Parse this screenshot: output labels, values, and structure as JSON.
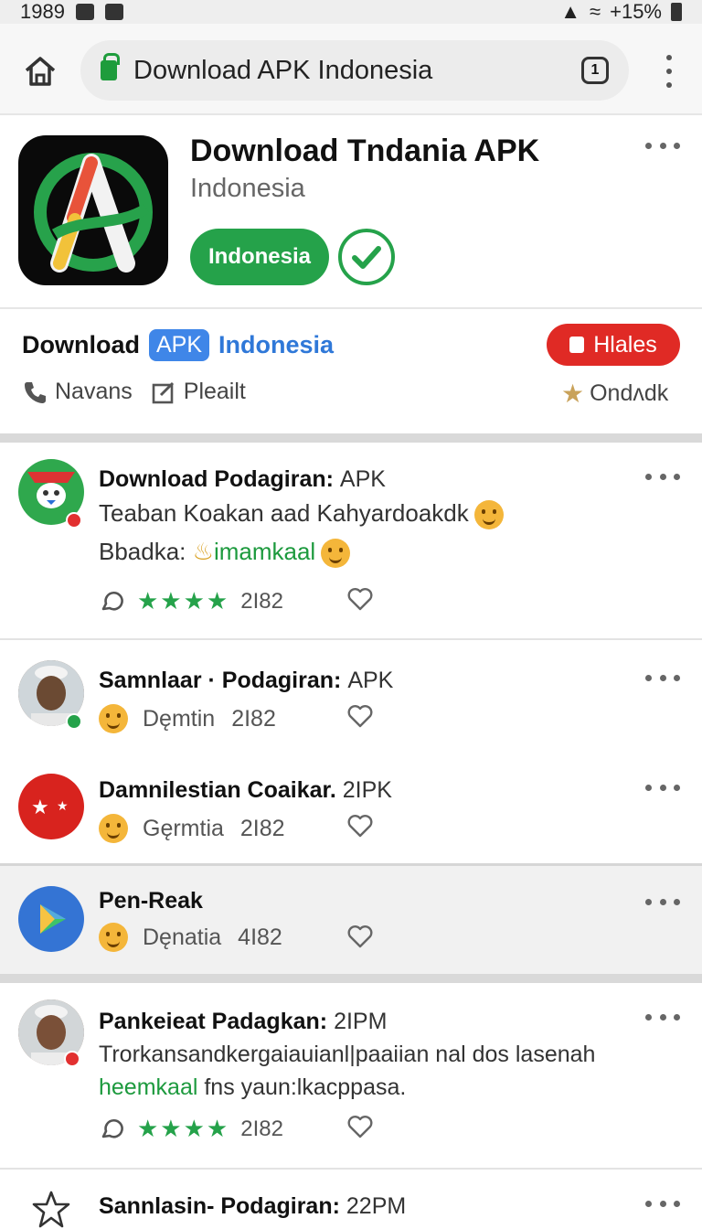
{
  "status_bar": {
    "time": "1989",
    "battery": "+15%"
  },
  "browser": {
    "url": "Download APK Indonesia",
    "tab_count": "1"
  },
  "app": {
    "title": "Download Tndania APK",
    "subtitle": "Indonesia",
    "badge": "Indonesia"
  },
  "download_strip": {
    "word": "Download",
    "chip": "APK",
    "link": "Indonesia",
    "button": "Hlales",
    "meta_left_1": "Navans",
    "meta_left_2": "Pleailt",
    "meta_right": "Ondʌdk"
  },
  "posts": [
    {
      "title": "Download Podagiran:",
      "title_suffix": "APK",
      "line1": "Teaban Koakan aad Kahyardoakdk",
      "line2_label": "Bbadka:",
      "line2_green": "imamkaal",
      "count": "2I82"
    },
    {
      "title": "Samnlaar · Podagiran:",
      "title_suffix": "APK",
      "meta": "Dęmtin",
      "count": "2I82"
    },
    {
      "title": "Damnilestian Coaikar.",
      "title_suffix": "2IPK",
      "meta": "Gęrmtia",
      "count": "2I82"
    },
    {
      "title": "Pen-Reak",
      "title_suffix": "",
      "meta": "Dęnatia",
      "count": "4I82"
    },
    {
      "title": "Pankeieat Padagkan:",
      "title_suffix": "2IPM",
      "line1": "Trorkansandkergaiauianl|paaiian nal dos lasenah",
      "line2_green": "heemkaal",
      "line2_rest": "fns yaun:lkacppasa.",
      "count": "2I82"
    },
    {
      "title": "Sannlasin- Podagiran:",
      "title_suffix": "22PM"
    }
  ],
  "colors": {
    "accent_green": "#25a24a",
    "link_blue": "#2f78d8",
    "alert_red": "#e02a25"
  }
}
